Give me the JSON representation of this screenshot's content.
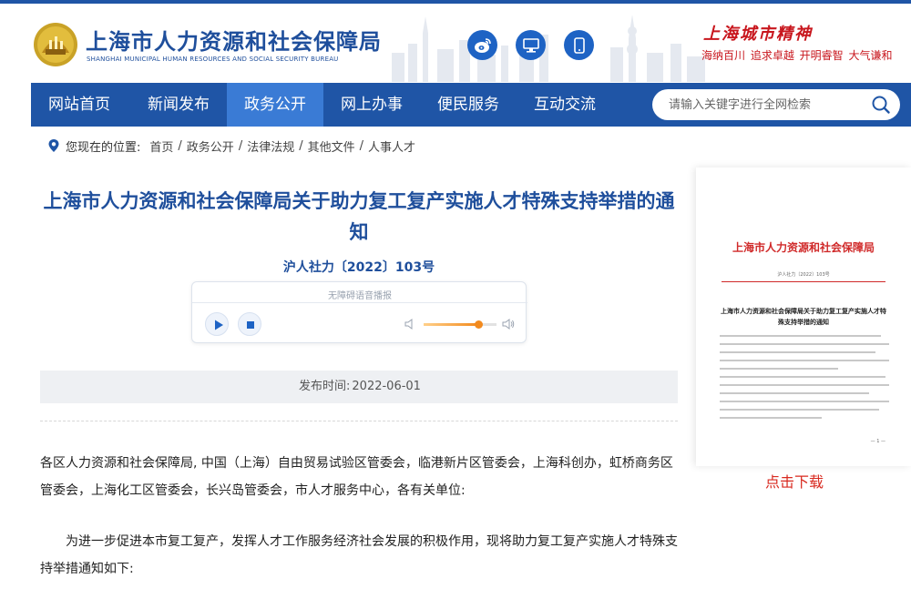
{
  "header": {
    "site_name": "上海市人力资源和社会保障局",
    "site_name_en": "SHANGHAI MUNICIPAL HUMAN RESOURCES AND SOCIAL SECURITY BUREAU",
    "spirit_title": "上海城市精神",
    "spirit_slogans": "海纳百川 追求卓越 开明睿智 大气谦和",
    "social_icons": [
      "weibo-icon",
      "desktop-icon",
      "mobile-icon"
    ]
  },
  "nav": {
    "items": [
      {
        "label": "网站首页",
        "active": false
      },
      {
        "label": "新闻发布",
        "active": false
      },
      {
        "label": "政务公开",
        "active": true
      },
      {
        "label": "网上办事",
        "active": false
      },
      {
        "label": "便民服务",
        "active": false
      },
      {
        "label": "互动交流",
        "active": false
      }
    ],
    "search_placeholder": "请输入关键字进行全网检索"
  },
  "breadcrumb": {
    "prefix": "您现在的位置:",
    "items": [
      "首页",
      "政务公开",
      "法律法规",
      "其他文件",
      "人事人才"
    ]
  },
  "article": {
    "title": "上海市人力资源和社会保障局关于助力复工复产实施人才特殊支持举措的通知",
    "doc_number": "沪人社力〔2022〕103号",
    "player_label": "无障碍语音播报",
    "volume_level": 0.75,
    "publish_label": "发布时间:",
    "publish_date": "2022-06-01",
    "paragraphs": [
      "各区人力资源和社会保障局, 中国（上海）自由贸易试验区管委会，临港新片区管委会，上海科创办，虹桥商务区管委会，上海化工区管委会，长兴岛管委会，市人才服务中心，各有关单位:",
      "为进一步促进本市复工复产，发挥人才工作服务经济社会发展的积极作用，现将助力复工复产实施人才特殊支持举措通知如下:"
    ]
  },
  "sidebar": {
    "doc_header": "上海市人力资源和社会保障局",
    "doc_number": "沪人社力〔2022〕103号",
    "doc_title": "上海市人力资源和社会保障局关于助力复工复产实施人才特殊支持举措的通知",
    "doc_page": "— 1 —",
    "download_label": "点击下载"
  },
  "colors": {
    "brand_blue": "#1f55a6",
    "nav_active": "#3a7bd5",
    "title_blue": "#1f4f9c",
    "accent_red": "#c8161d",
    "volume_orange": "#f28a1e"
  }
}
